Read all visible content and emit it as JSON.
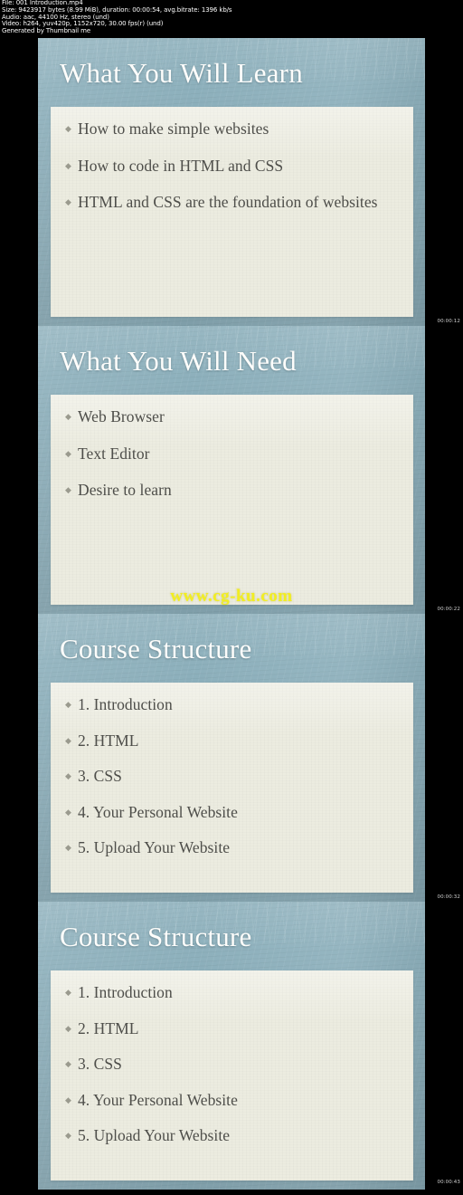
{
  "meta": {
    "line_file": "File: 001 Introduction.mp4",
    "line_size": "Size: 9423917 bytes (8.99 MiB), duration: 00:00:54, avg.bitrate: 1396 kb/s",
    "line_audio": "Audio: aac, 44100 Hz, stereo (und)",
    "line_video": "Video: h264, yuv420p, 1152x720, 30.00 fps(r) (und)",
    "line_generator": "Generated by Thumbnail me"
  },
  "colors": {
    "page_background": "#000000",
    "slide_background": "#8db0bc",
    "content_panel": "#ecece0",
    "title_text": "#fdfdfb",
    "body_text": "#4e4e4a",
    "bullet_mark": "#9a9a8e",
    "watermark": "#f2ee21",
    "meta_text": "#ffffff",
    "timestamp_text": "#cfcfcf"
  },
  "bullet_glyph": "◆",
  "watermark_text": "www.cg-ku.com",
  "slides": [
    {
      "title": "What You Will Learn",
      "timestamp": "00:00:12",
      "density": "density-3",
      "watermark": false,
      "bullets": [
        "How to make simple websites",
        "How to code in HTML and CSS",
        "HTML and CSS are the foundation of websites"
      ]
    },
    {
      "title": "What You Will Need",
      "timestamp": "00:00:22",
      "density": "density-3",
      "watermark": true,
      "bullets": [
        "Web Browser",
        "Text Editor",
        "Desire to learn"
      ]
    },
    {
      "title": "Course Structure",
      "timestamp": "00:00:32",
      "density": "density-5",
      "watermark": false,
      "bullets": [
        "1. Introduction",
        "2. HTML",
        "3. CSS",
        "4. Your Personal Website",
        "5. Upload Your Website"
      ]
    },
    {
      "title": "Course Structure",
      "timestamp": "00:00:43",
      "density": "density-5",
      "watermark": false,
      "bullets": [
        "1. Introduction",
        "2. HTML",
        "3. CSS",
        "4. Your Personal Website",
        "5. Upload Your Website"
      ]
    }
  ]
}
